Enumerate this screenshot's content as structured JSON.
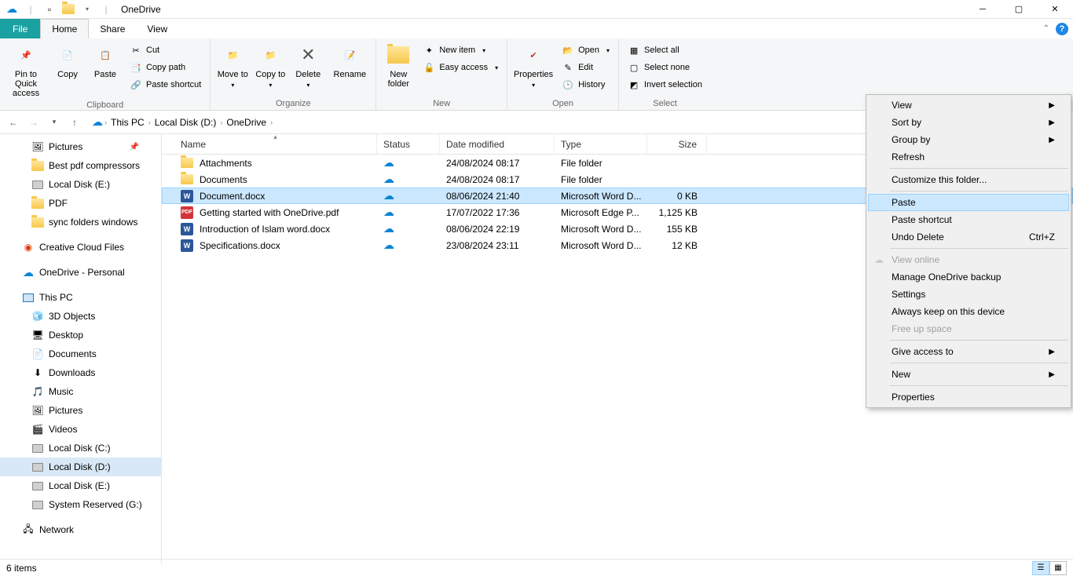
{
  "titlebar": {
    "title": "OneDrive"
  },
  "tabs": {
    "file": "File",
    "home": "Home",
    "share": "Share",
    "view": "View"
  },
  "ribbon": {
    "clipboard": {
      "label": "Clipboard",
      "pin": "Pin to Quick access",
      "copy": "Copy",
      "paste": "Paste",
      "cut": "Cut",
      "copypath": "Copy path",
      "pasteshortcut": "Paste shortcut"
    },
    "organize": {
      "label": "Organize",
      "moveto": "Move to",
      "copyto": "Copy to",
      "delete": "Delete",
      "rename": "Rename"
    },
    "new": {
      "label": "New",
      "newfolder": "New folder",
      "newitem": "New item",
      "easyaccess": "Easy access"
    },
    "open": {
      "label": "Open",
      "properties": "Properties",
      "open": "Open",
      "edit": "Edit",
      "history": "History"
    },
    "select": {
      "label": "Select",
      "selectall": "Select all",
      "selectnone": "Select none",
      "invert": "Invert selection"
    }
  },
  "breadcrumb": {
    "thispc": "This PC",
    "drive": "Local Disk (D:)",
    "folder": "OneDrive"
  },
  "columns": {
    "name": "Name",
    "status": "Status",
    "date": "Date modified",
    "type": "Type",
    "size": "Size"
  },
  "files": [
    {
      "name": "Attachments",
      "date": "24/08/2024 08:17",
      "type": "File folder",
      "size": "",
      "kind": "folder"
    },
    {
      "name": "Documents",
      "date": "24/08/2024 08:17",
      "type": "File folder",
      "size": "",
      "kind": "folder"
    },
    {
      "name": "Document.docx",
      "date": "08/06/2024 21:40",
      "type": "Microsoft Word D...",
      "size": "0 KB",
      "kind": "word",
      "selected": true
    },
    {
      "name": "Getting started with OneDrive.pdf",
      "date": "17/07/2022 17:36",
      "type": "Microsoft Edge P...",
      "size": "1,125 KB",
      "kind": "pdf"
    },
    {
      "name": "Introduction of Islam word.docx",
      "date": "08/06/2024 22:19",
      "type": "Microsoft Word D...",
      "size": "155 KB",
      "kind": "word"
    },
    {
      "name": "Specifications.docx",
      "date": "23/08/2024 23:11",
      "type": "Microsoft Word D...",
      "size": "12 KB",
      "kind": "word"
    }
  ],
  "nav": {
    "pictures": "Pictures",
    "bestpdf": "Best pdf compressors",
    "driveE": "Local Disk (E:)",
    "pdf": "PDF",
    "syncfolders": "sync folders windows",
    "ccfiles": "Creative Cloud Files",
    "onedrive": "OneDrive - Personal",
    "thispc": "This PC",
    "objects3d": "3D Objects",
    "desktop": "Desktop",
    "documents": "Documents",
    "downloads": "Downloads",
    "music": "Music",
    "pictures2": "Pictures",
    "videos": "Videos",
    "driveC": "Local Disk (C:)",
    "driveD": "Local Disk (D:)",
    "driveE2": "Local Disk (E:)",
    "sysres": "System Reserved (G:)",
    "network": "Network"
  },
  "ctx": {
    "view": "View",
    "sortby": "Sort by",
    "groupby": "Group by",
    "refresh": "Refresh",
    "customize": "Customize this folder...",
    "paste": "Paste",
    "pasteshortcut": "Paste shortcut",
    "undodelete": "Undo Delete",
    "undodelete_sc": "Ctrl+Z",
    "viewonline": "View online",
    "managebackup": "Manage OneDrive backup",
    "settings": "Settings",
    "alwayskeep": "Always keep on this device",
    "freeup": "Free up space",
    "giveaccess": "Give access to",
    "new": "New",
    "properties": "Properties"
  },
  "status": {
    "items": "6 items"
  }
}
